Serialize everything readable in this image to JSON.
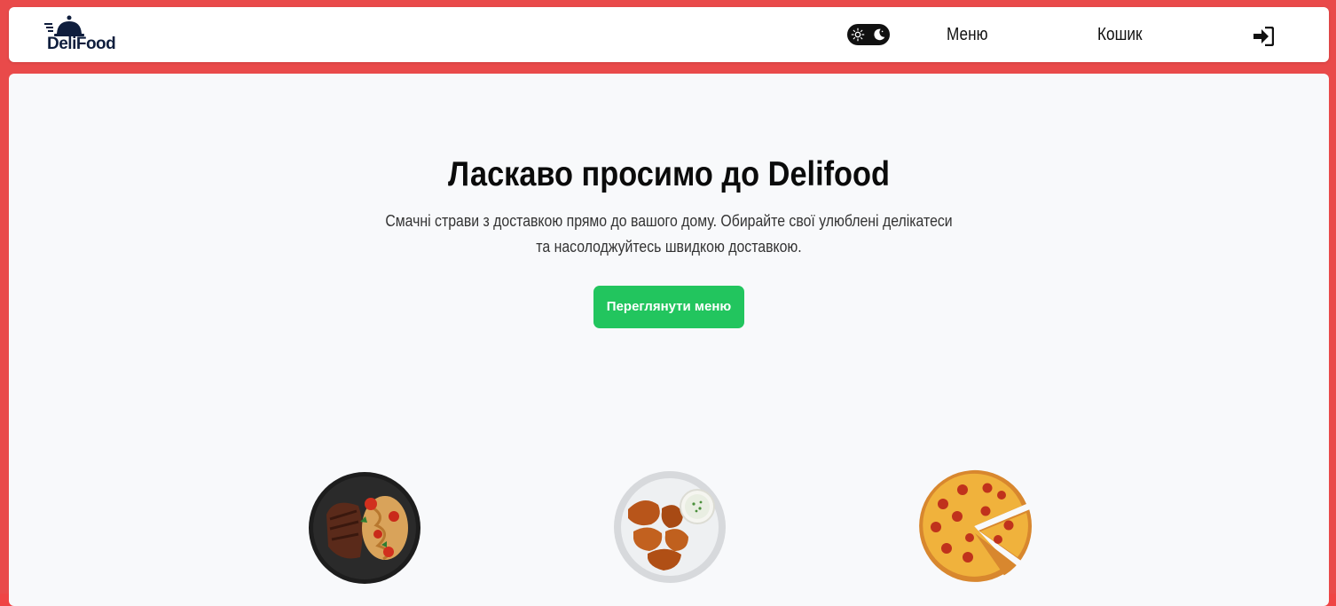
{
  "header": {
    "logo_text": "DeliFood",
    "nav": {
      "menu": "Меню",
      "cart": "Кошик"
    }
  },
  "hero": {
    "title": "Ласкаво просимо до Delifood",
    "subtitle": "Смачні страви з доставкою прямо до вашого дому. Обирайте свої улюблені делікатеси та насолоджуйтесь швидкою доставкою.",
    "cta_label": "Переглянути меню"
  },
  "colors": {
    "page_bg": "#e94a4a",
    "accent": "#22c55e",
    "brand_navy": "#0f1e3d"
  },
  "icons": [
    "cloche-logo-icon",
    "sun-icon",
    "moon-icon",
    "sign-in-icon"
  ],
  "dishes": [
    {
      "icon": "steak-pasta-plate-icon"
    },
    {
      "icon": "chicken-wings-plate-icon"
    },
    {
      "icon": "pepperoni-pizza-icon"
    }
  ]
}
